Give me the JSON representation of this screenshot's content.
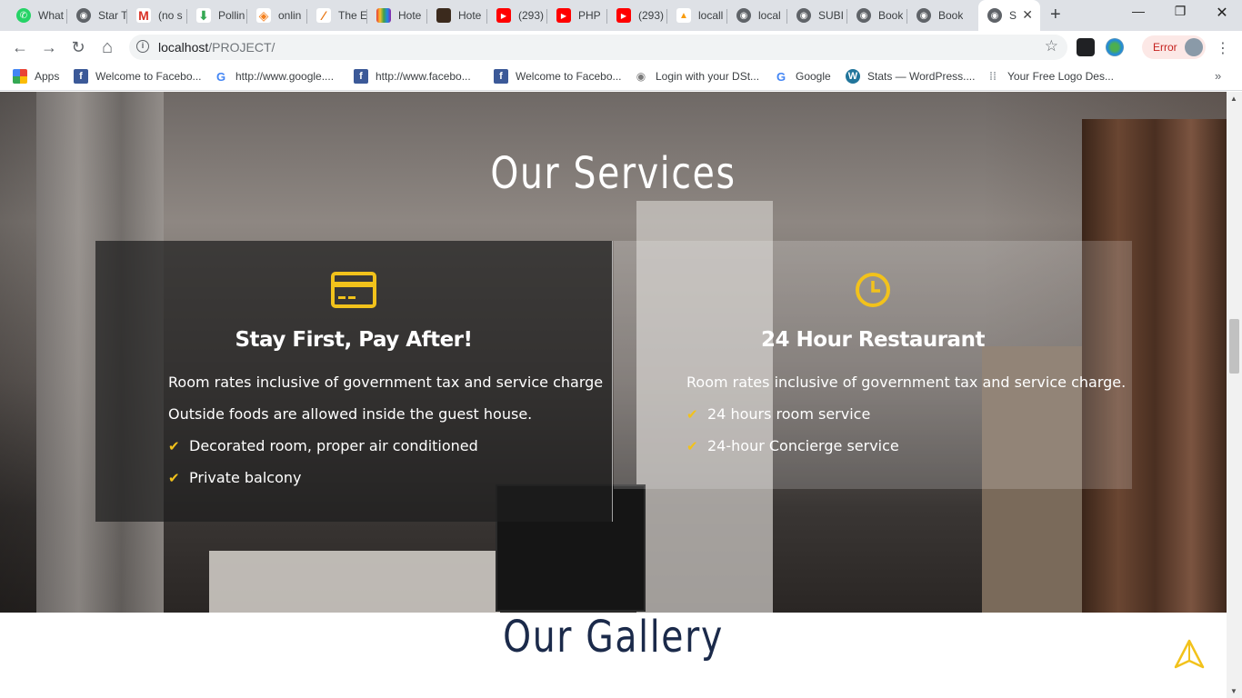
{
  "browser": {
    "tabs": [
      {
        "title": "What",
        "favicon_color": "#25d366",
        "favicon": "whatsapp-icon"
      },
      {
        "title": "Star T",
        "favicon_color": "#5f6368",
        "favicon": "globe-icon"
      },
      {
        "title": "(no s",
        "favicon_color": "#d93025",
        "favicon": "gmail-icon"
      },
      {
        "title": "Pollin",
        "favicon_color": "#34a853",
        "favicon": "download-icon"
      },
      {
        "title": "onlin",
        "favicon_color": "#f4811f",
        "favicon": "diamond-icon"
      },
      {
        "title": "The E",
        "favicon_color": "#e8710a",
        "favicon": "sublime-icon"
      },
      {
        "title": "Hote",
        "favicon_color": "#7b3fa0",
        "favicon": "grid-icon"
      },
      {
        "title": "Hote",
        "favicon_color": "#3b2a1d",
        "favicon": "image-icon"
      },
      {
        "title": "(293)",
        "favicon_color": "#ff0000",
        "favicon": "youtube-icon"
      },
      {
        "title": "PHP",
        "favicon_color": "#ff0000",
        "favicon": "youtube-icon"
      },
      {
        "title": "(293)",
        "favicon_color": "#ff0000",
        "favicon": "youtube-icon"
      },
      {
        "title": "locall",
        "favicon_color": "#f89c0e",
        "favicon": "phpmyadmin-icon"
      },
      {
        "title": "local",
        "favicon_color": "#5f6368",
        "favicon": "globe-icon"
      },
      {
        "title": "SUBI",
        "favicon_color": "#5f6368",
        "favicon": "globe-icon"
      },
      {
        "title": "Book",
        "favicon_color": "#5f6368",
        "favicon": "globe-icon"
      },
      {
        "title": "Book",
        "favicon_color": "#5f6368",
        "favicon": "globe-icon"
      },
      {
        "title": "S",
        "favicon_color": "#5f6368",
        "favicon": "globe-icon",
        "active": true
      }
    ],
    "close_tab_glyph": "✕",
    "new_tab_glyph": "+",
    "window_controls": {
      "minimize": "—",
      "maximize": "❐",
      "close": "✕"
    },
    "nav": {
      "back": "←",
      "forward": "→",
      "reload": "↻",
      "home": "⌂"
    },
    "address": {
      "host": "localhost",
      "path": "/PROJECT/",
      "info_glyph": "i",
      "star_glyph": "☆"
    },
    "profile_button": {
      "label": "Error"
    },
    "menu_glyph": "⋮",
    "bookmarks": [
      {
        "label": "Apps",
        "icon": "apps-grid-icon",
        "color": "#e8710a"
      },
      {
        "label": "Welcome to Facebo...",
        "icon": "facebook-icon",
        "color": "#3b5998"
      },
      {
        "label": "http://www.google....",
        "icon": "google-icon",
        "color": "#4285f4"
      },
      {
        "label": "http://www.facebo...",
        "icon": "facebook-icon",
        "color": "#3b5998"
      },
      {
        "label": "Welcome to Facebo...",
        "icon": "facebook-icon",
        "color": "#3b5998"
      },
      {
        "label": "Login with your DSt...",
        "icon": "eye-icon",
        "color": "#7a7a7a"
      },
      {
        "label": "Google",
        "icon": "google-icon",
        "color": "#4285f4"
      },
      {
        "label": "Stats — WordPress....",
        "icon": "wordpress-icon",
        "color": "#21759b"
      },
      {
        "label": "Your Free Logo Des...",
        "icon": "dots-grid-icon",
        "color": "#9aa0a6"
      }
    ],
    "bookmarks_overflow": "»"
  },
  "page": {
    "services_title": "Our Services",
    "cards": [
      {
        "title": "Stay First, Pay After!",
        "icon": "credit-card-icon",
        "lines": [
          "Room rates inclusive of government tax and service charge",
          "Outside foods are allowed inside the guest house."
        ],
        "checks": [
          "Decorated room, proper air conditioned",
          "Private balcony"
        ]
      },
      {
        "title": "24 Hour Restaurant",
        "icon": "clock-icon",
        "lines": [
          "Room rates inclusive of government tax and service charge."
        ],
        "checks": [
          "24 hours room service",
          "24-hour Concierge service"
        ]
      }
    ],
    "check_glyph": "✔",
    "gallery_title": "Our Gallery",
    "accent_color": "#f2c21b",
    "gallery_title_color": "#1b2a4a"
  }
}
